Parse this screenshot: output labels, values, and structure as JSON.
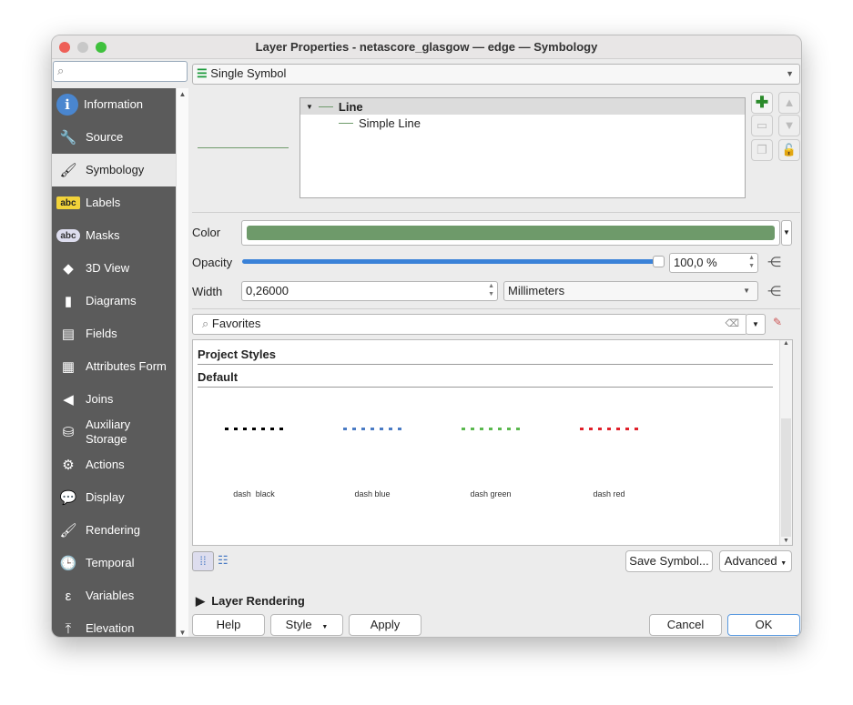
{
  "window": {
    "title": "Layer Properties - netascore_glasgow — edge — Symbology"
  },
  "sidebar": {
    "search_placeholder": "",
    "items": [
      {
        "label": "Information",
        "icon": "info-icon"
      },
      {
        "label": "Source",
        "icon": "source-icon"
      },
      {
        "label": "Symbology",
        "icon": "symbology-icon",
        "selected": true
      },
      {
        "label": "Labels",
        "icon": "labels-icon"
      },
      {
        "label": "Masks",
        "icon": "masks-icon"
      },
      {
        "label": "3D View",
        "icon": "3d-view-icon"
      },
      {
        "label": "Diagrams",
        "icon": "diagrams-icon"
      },
      {
        "label": "Fields",
        "icon": "fields-icon"
      },
      {
        "label": "Attributes Form",
        "icon": "attributes-form-icon"
      },
      {
        "label": "Joins",
        "icon": "joins-icon"
      },
      {
        "label": "Auxiliary\nStorage",
        "icon": "auxiliary-storage-icon"
      },
      {
        "label": "Actions",
        "icon": "actions-icon"
      },
      {
        "label": "Display",
        "icon": "display-icon"
      },
      {
        "label": "Rendering",
        "icon": "rendering-icon"
      },
      {
        "label": "Temporal",
        "icon": "temporal-icon"
      },
      {
        "label": "Variables",
        "icon": "variables-icon"
      },
      {
        "label": "Elevation",
        "icon": "elevation-icon"
      }
    ]
  },
  "renderer": {
    "selected": "Single Symbol"
  },
  "symbol_tree": {
    "root": "Line",
    "child": "Simple Line"
  },
  "props": {
    "color_label": "Color",
    "color": "#6e9a6a",
    "opacity_label": "Opacity",
    "opacity_value": "100,0 %",
    "opacity_fraction": 1.0,
    "width_label": "Width",
    "width_value": "0,26000",
    "unit": "Millimeters"
  },
  "library": {
    "filter": "Favorites",
    "groups": [
      "Project Styles",
      "Default"
    ],
    "symbols": [
      {
        "name": "dash  black",
        "color": "#000000"
      },
      {
        "name": "dash blue",
        "color": "#4a7bc4"
      },
      {
        "name": "dash green",
        "color": "#5ab84e"
      },
      {
        "name": "dash red",
        "color": "#e0202a"
      }
    ]
  },
  "buttons": {
    "save_symbol": "Save Symbol...",
    "advanced": "Advanced",
    "layer_rendering": "Layer Rendering",
    "help": "Help",
    "style": "Style",
    "apply": "Apply",
    "cancel": "Cancel",
    "ok": "OK"
  }
}
